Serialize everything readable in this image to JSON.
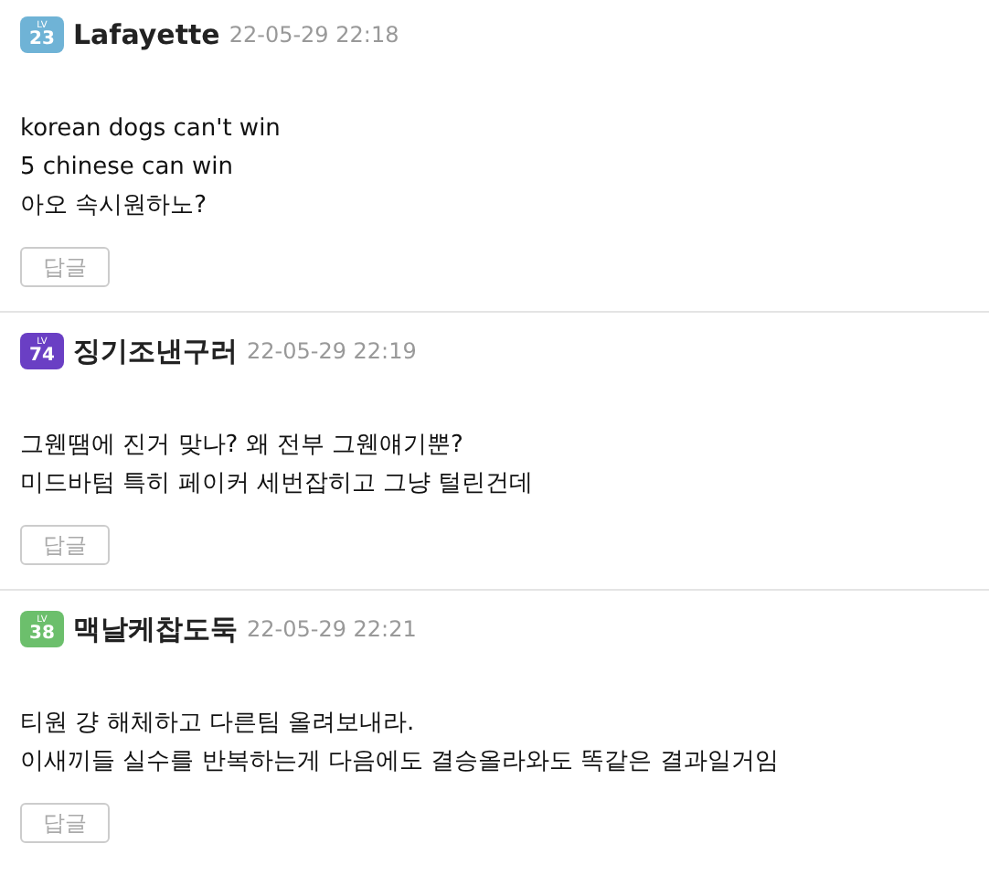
{
  "comments": [
    {
      "badge": {
        "label": "LV",
        "level": "23",
        "color": "#6fb3d6"
      },
      "author": "Lafayette",
      "time": "22-05-29 22:18",
      "text": "korean dogs can't win\n5 chinese can win\n아오 속시원하노?",
      "reply_button": "답글"
    },
    {
      "badge": {
        "label": "LV",
        "level": "74",
        "color": "#6a3fc4"
      },
      "author": "징기조낸구러",
      "time": "22-05-29 22:19",
      "text": "그웬땜에 진거 맞나? 왜 전부 그웬얘기뿐?\n미드바텀 특히 페이커 세번잡히고 그냥 털린건데",
      "reply_button": "답글"
    },
    {
      "badge": {
        "label": "LV",
        "level": "38",
        "color": "#6cbf6c"
      },
      "author": "맥날케찹도둑",
      "time": "22-05-29 22:21",
      "text": "티원 걍 해체하고 다른팀 올려보내라.\n이새끼들 실수를 반복하는게 다음에도 결승올라와도 똑같은 결과일거임",
      "reply_button": "답글"
    }
  ]
}
